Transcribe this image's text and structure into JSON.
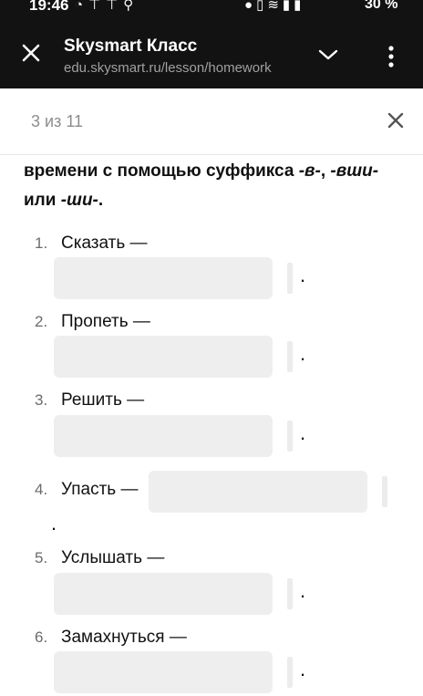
{
  "status_bar": {
    "time": "19:46",
    "battery": "30 %"
  },
  "app_bar": {
    "title": "Skysmart Класс",
    "url": "edu.skysmart.ru/lesson/homework"
  },
  "dialog": {
    "counter": "3 из 11"
  },
  "task": {
    "intro_text_1": "времени с помощью суффикса ",
    "suffix_1": "-в-",
    "intro_sep": ", ",
    "suffix_2": "-вши-",
    "intro_or": "или ",
    "suffix_3": "-ши-",
    "intro_end": ".",
    "items": [
      {
        "number": "1.",
        "word": "Сказать —",
        "answer": "",
        "end": "."
      },
      {
        "number": "2.",
        "word": "Пропеть —",
        "answer": "",
        "end": "."
      },
      {
        "number": "3.",
        "word": "Решить —",
        "answer": "",
        "end": "."
      },
      {
        "number": "4.",
        "word": "Упасть —",
        "answer": "",
        "end": "."
      },
      {
        "number": "5.",
        "word": "Услышать —",
        "answer": "",
        "end": "."
      },
      {
        "number": "6.",
        "word": "Замахнуться —",
        "answer": "",
        "end": "."
      }
    ]
  },
  "icons": {
    "status_left": [
      "app-icon",
      "pin-icon",
      "pin-icon",
      "search-icon"
    ],
    "status_right": [
      "alarm-icon",
      "vibrate-icon",
      "wifi-icon",
      "signal-icon",
      "battery-icon"
    ],
    "app_close": "close-icon",
    "app_expand": "chevron-down-icon",
    "app_menu": "more-vertical-icon",
    "dialog_close": "close-icon"
  },
  "colors": {
    "app_bar_bg": "#121212",
    "field_bg": "#eeeeee",
    "muted_text": "#8c8c8c"
  }
}
